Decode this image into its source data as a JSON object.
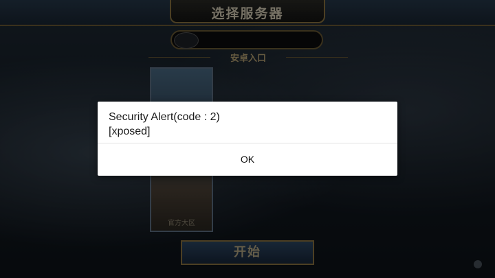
{
  "game": {
    "title": "选择服务器",
    "server_label": "安卓入口",
    "hero_label": "官方大区",
    "start_label": "开始"
  },
  "dialog": {
    "line1": "Security Alert(code : 2)",
    "line2": "[xposed]",
    "ok_label": "OK"
  }
}
